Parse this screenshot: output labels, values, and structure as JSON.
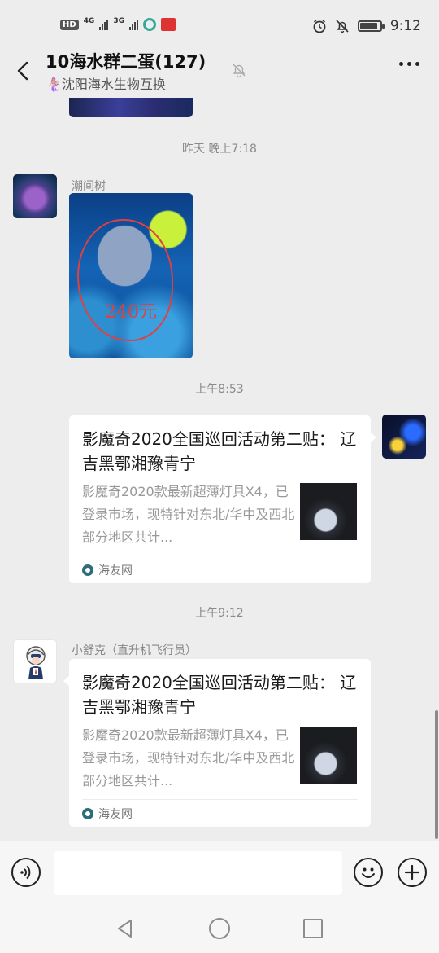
{
  "status_bar": {
    "hd": "HD",
    "net1": "4G",
    "net2": "3G",
    "time": "9:12",
    "battery_level": 0.9
  },
  "header": {
    "title": "10海水群二蛋(127)",
    "subtitle": "🧜🏼‍♀️沈阳海水生物互换",
    "icons": [
      "back-arrow-icon",
      "mute-bell-icon",
      "more-icon"
    ]
  },
  "chat": {
    "timestamps": [
      "昨天 晚上7:18",
      "上午8:53",
      "上午9:12"
    ],
    "msg1": {
      "sender": "潮间树",
      "photo_annotation": "240元"
    },
    "msg2": {
      "card": {
        "title": "影魔奇2020全国巡回活动第二贴： 辽吉黑鄂湘豫青宁",
        "desc": "影魔奇2020款最新超薄灯具X4，已登录市场，现特针对东北/华中及西北部分地区共计...",
        "source": "海友网"
      }
    },
    "msg3": {
      "sender": "小舒克（直升机飞行员）",
      "card": {
        "title": "影魔奇2020全国巡回活动第二贴： 辽吉黑鄂湘豫青宁",
        "desc": "影魔奇2020款最新超薄灯具X4，已登录市场，现特针对东北/华中及西北部分地区共计...",
        "source": "海友网"
      }
    }
  },
  "input_bar": {
    "placeholder": "",
    "icons": [
      "voice-icon",
      "emoji-icon",
      "plus-icon"
    ]
  },
  "nav_bar": {
    "icons": [
      "nav-back-icon",
      "nav-home-icon",
      "nav-recent-icon"
    ]
  }
}
